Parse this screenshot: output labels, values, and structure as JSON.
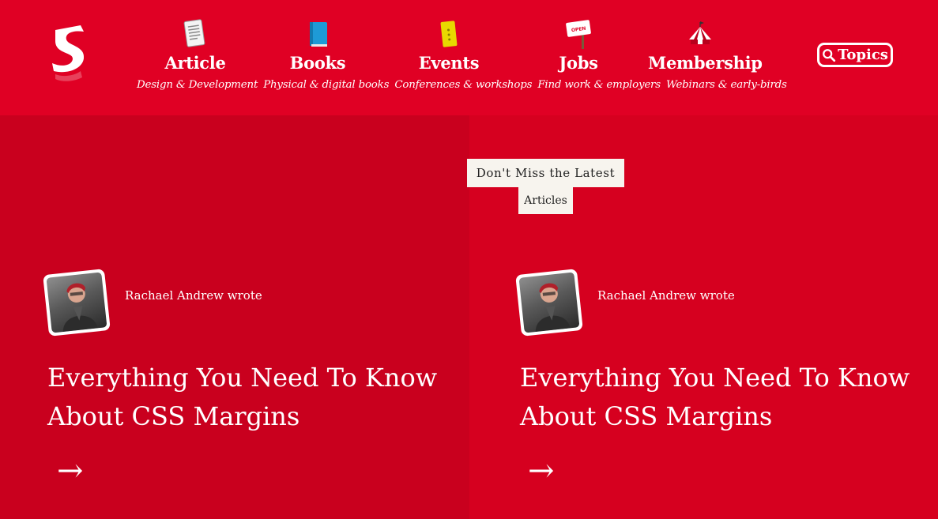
{
  "header": {
    "nav": [
      {
        "label": "Article",
        "icon": "tablet-icon"
      },
      {
        "label": "Books",
        "icon": "book-icon"
      },
      {
        "label": "Events",
        "icon": "ticket-icon"
      },
      {
        "label": "Jobs",
        "icon": "open-sign-icon"
      },
      {
        "label": "Membership",
        "icon": "circus-tent-icon"
      }
    ],
    "subtitles": [
      "Design & Development",
      "Physical & digital books",
      "Conferences & workshops",
      "Find work & employers",
      "Webinars & early-birds"
    ],
    "jobs_sign_text": "OPEN",
    "topics_label": "Topics"
  },
  "banner": {
    "line1": "Don't Miss the Latest",
    "line2": "Articles"
  },
  "cards": [
    {
      "author": "Rachael Andrew wrote",
      "title_line1": "Everything You Need To Know",
      "title_line2": "About CSS Margins",
      "arrow": "→"
    },
    {
      "author": "Rachael Andrew wrote",
      "title_line1": "Everything You Need To Know",
      "title_line2": "About CSS Margins",
      "arrow": "→"
    }
  ],
  "colors": {
    "brand_red": "#e00024",
    "panel_left": "#c9001e",
    "panel_right": "#d6001f",
    "banner_bg": "#f7f4ee"
  }
}
